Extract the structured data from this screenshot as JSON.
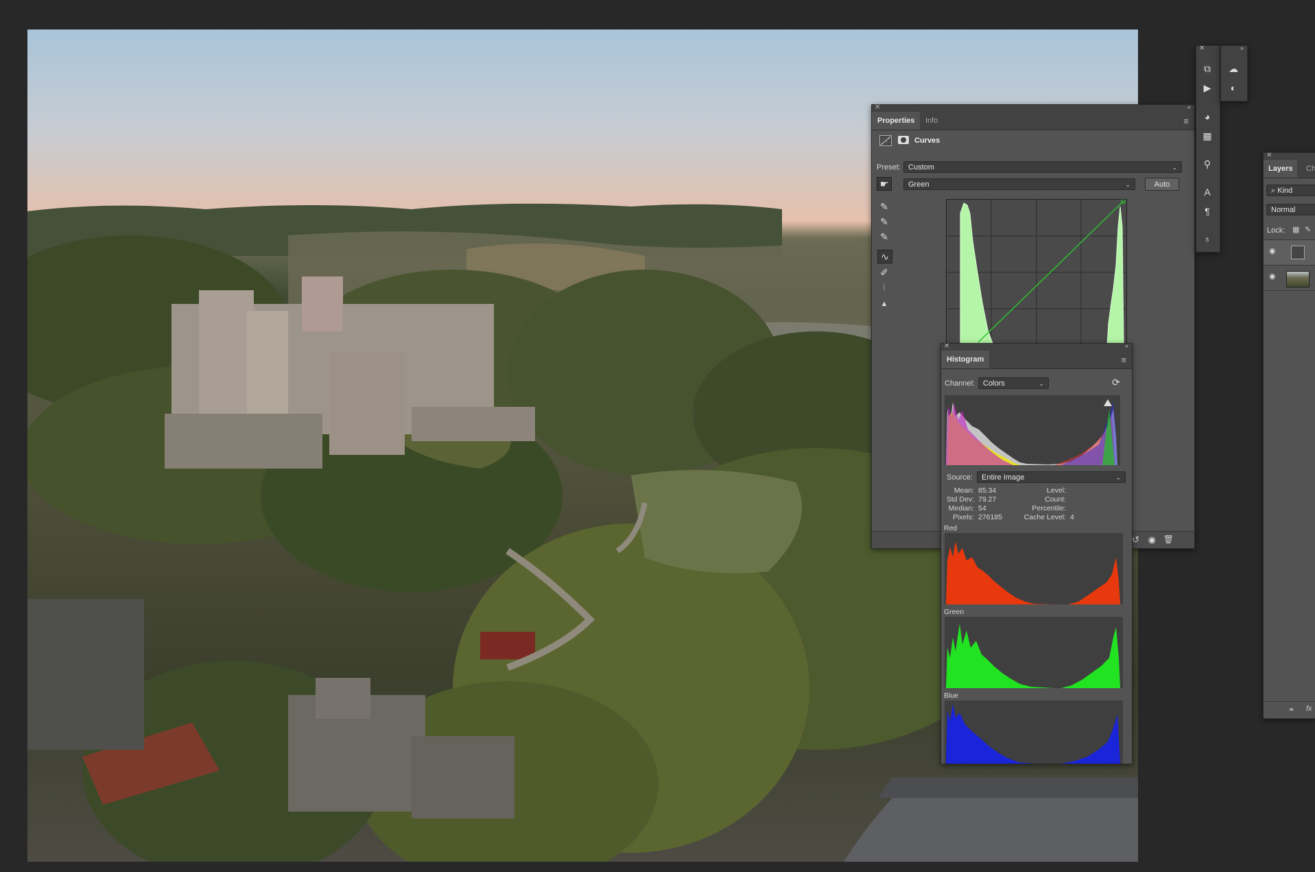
{
  "properties_panel": {
    "tabs": [
      "Properties",
      "Info"
    ],
    "adjustment_title": "Curves",
    "preset_label": "Preset:",
    "preset_value": "Custom",
    "channel_value": "Green",
    "auto_button": "Auto"
  },
  "histogram_panel": {
    "tab": "Histogram",
    "channel_label": "Channel:",
    "channel_value": "Colors",
    "source_label": "Source:",
    "source_value": "Entire Image",
    "stats_left": [
      {
        "label": "Mean:",
        "value": "85.34"
      },
      {
        "label": "Std Dev:",
        "value": "79.27"
      },
      {
        "label": "Median:",
        "value": "54"
      },
      {
        "label": "Pixels:",
        "value": "276185"
      }
    ],
    "stats_right": [
      {
        "label": "Level:",
        "value": ""
      },
      {
        "label": "Count:",
        "value": ""
      },
      {
        "label": "Percentile:",
        "value": ""
      },
      {
        "label": "Cache Level:",
        "value": "4"
      }
    ],
    "channels": [
      {
        "name": "Red",
        "color": "#e8380d"
      },
      {
        "name": "Green",
        "color": "#22e322"
      },
      {
        "name": "Blue",
        "color": "#1a24d8"
      }
    ]
  },
  "layers_panel": {
    "tabs": [
      "Layers",
      "Ch"
    ],
    "filter_label": "Kind",
    "blend_mode": "Normal",
    "lock_label": "Lock:",
    "footer_fx": "fx"
  },
  "tools_panel": {
    "icons": [
      "history-brush-icon",
      "play-action-icon",
      "color-palette-icon",
      "swatches-grid-icon",
      "clone-source-icon",
      "character-type-icon",
      "paragraph-icon",
      "lightbulb-icon"
    ],
    "secondary_icons": [
      "libraries-cloud-icon",
      "adjustments-icon"
    ]
  },
  "colors": {
    "curve_line": "#2dc02d",
    "curve_histogram_fill": "#b5f5a8"
  }
}
